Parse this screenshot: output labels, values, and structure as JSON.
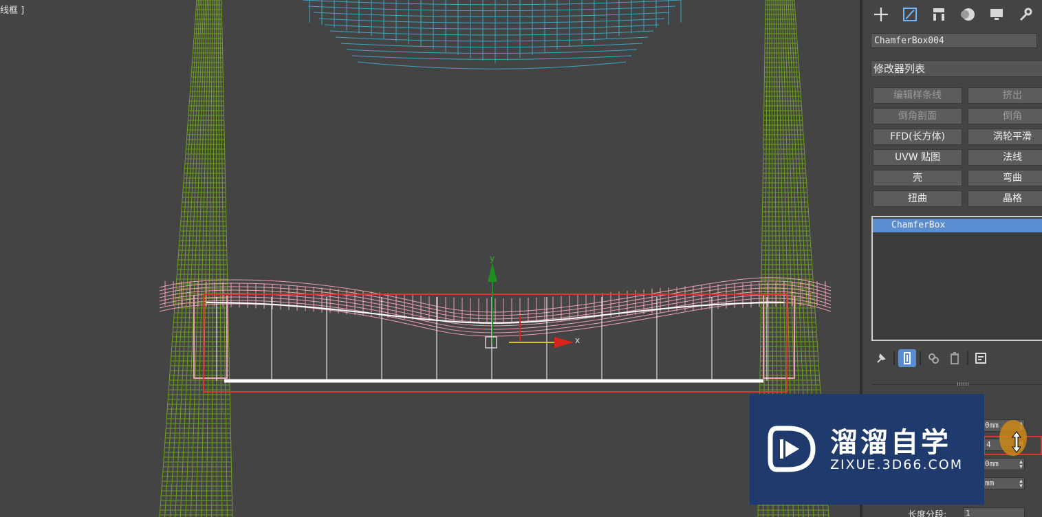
{
  "viewport": {
    "label": "线框 ]",
    "axis_x": "x",
    "axis_y": "y"
  },
  "panel": {
    "tabs": [
      {
        "name": "create-icon"
      },
      {
        "name": "modify-icon"
      },
      {
        "name": "hierarchy-icon"
      },
      {
        "name": "motion-icon"
      },
      {
        "name": "display-icon"
      },
      {
        "name": "utilities-icon"
      }
    ],
    "object_name": "ChamferBox004",
    "modifier_list": "修改器列表",
    "modifier_buttons": [
      {
        "label": "编辑样条线",
        "enabled": false
      },
      {
        "label": "挤出",
        "enabled": false
      },
      {
        "label": "倒角剖面",
        "enabled": false
      },
      {
        "label": "倒角",
        "enabled": false
      },
      {
        "label": "FFD(长方体)",
        "enabled": true
      },
      {
        "label": "涡轮平滑",
        "enabled": true
      },
      {
        "label": "UVW 贴图",
        "enabled": true
      },
      {
        "label": "法线",
        "enabled": true
      },
      {
        "label": "壳",
        "enabled": true
      },
      {
        "label": "弯曲",
        "enabled": true
      },
      {
        "label": "扭曲",
        "enabled": true
      },
      {
        "label": "晶格",
        "enabled": true
      }
    ],
    "stack_items": [
      "ChamferBox"
    ],
    "params": {
      "spin1": "0mm",
      "spin2": "4",
      "spin3": "0mm",
      "spin4": "mm",
      "length_segments_label": "长度分段:",
      "length_segments_value": "1"
    }
  },
  "watermark": {
    "title": "溜溜自学",
    "url": "ZIXUE.3D66.COM"
  },
  "colors": {
    "viewport_bg": "#444444",
    "wire_green": "#6fa01f",
    "wire_cyan": "#38b4d4",
    "wire_pink": "#f0a0b4",
    "selection_red": "#e2342f",
    "accent_blue": "#5b8ed0",
    "watermark_bg": "#1f3a6c"
  }
}
